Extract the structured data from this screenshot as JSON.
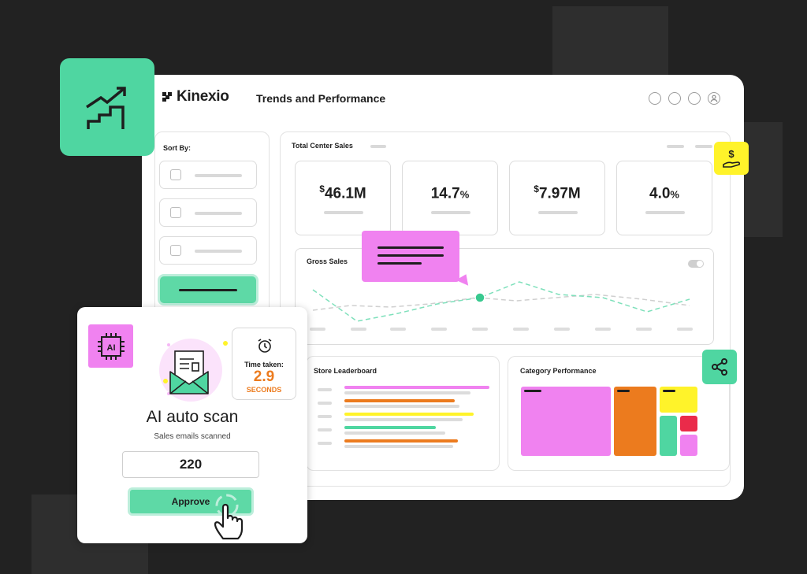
{
  "app": {
    "brand": "Kinexio",
    "page_title": "Trends and Performance"
  },
  "sidebar": {
    "sort_label": "Sort By:"
  },
  "sales": {
    "section_label": "Total Center Sales",
    "stats": [
      {
        "prefix": "$",
        "value": "46.1M",
        "suffix": ""
      },
      {
        "prefix": "",
        "value": "14.7",
        "suffix": "%"
      },
      {
        "prefix": "$",
        "value": "7.97M",
        "suffix": ""
      },
      {
        "prefix": "",
        "value": "4.0",
        "suffix": "%"
      }
    ]
  },
  "gross_sales": {
    "label": "Gross Sales"
  },
  "store_leaderboard": {
    "label": "Store Leaderboard"
  },
  "category_performance": {
    "label": "Category Performance"
  },
  "scan_card": {
    "icon_text": "AI",
    "timer_label": "Time taken:",
    "timer_value": "2.9",
    "timer_unit": "SECONDS",
    "title": "AI auto scan",
    "subtitle": "Sales emails scanned",
    "count": "220",
    "approve_label": "Approve"
  },
  "colors": {
    "accent_green": "#4fd6a1",
    "accent_pink": "#f082f0",
    "accent_yellow": "#fff32a",
    "accent_orange": "#ec7b1e",
    "accent_red": "#ea2b4a"
  }
}
